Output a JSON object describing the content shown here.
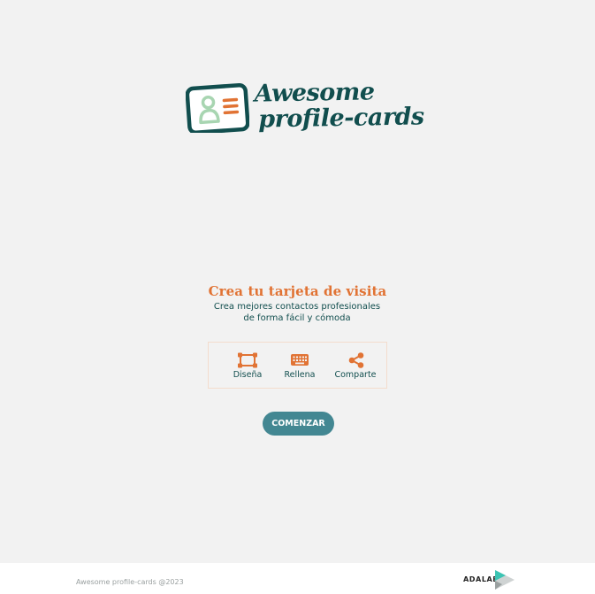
{
  "header": {
    "logo": {
      "line1": "Awesome",
      "line2": "profile-cards",
      "icon": "profile-card-icon"
    }
  },
  "hero": {
    "title": "Crea tu tarjeta de visita",
    "subtitle": "Crea mejores contactos profesionales de forma fácil y cómoda"
  },
  "steps": [
    {
      "label": "Diseña",
      "icon": "design-icon"
    },
    {
      "label": "Rellena",
      "icon": "keyboard-icon"
    },
    {
      "label": "Comparte",
      "icon": "share-icon"
    }
  ],
  "start_button": {
    "label": "COMENZAR"
  },
  "footer": {
    "copyright": "Awesome profile-cards @2023",
    "brand": "ADALAB"
  },
  "colors": {
    "background": "#f2f2f2",
    "primary_dark": "#114e4e",
    "accent_orange": "#e17334",
    "button": "#438792",
    "logo_green": "#a8d5b1"
  }
}
